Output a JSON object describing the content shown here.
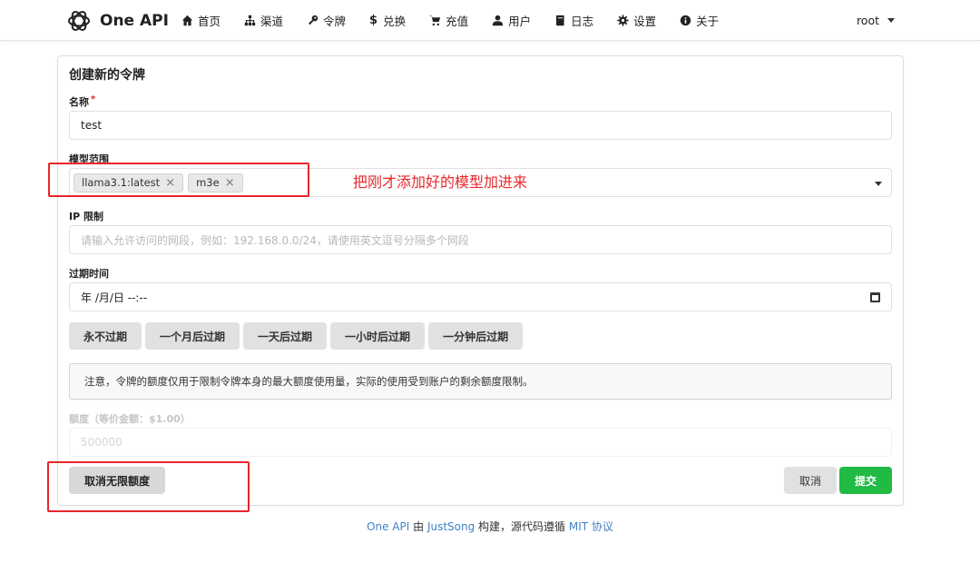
{
  "app": {
    "name": "One API"
  },
  "nav": {
    "items": [
      {
        "label": "首页",
        "icon": "home-icon"
      },
      {
        "label": "渠道",
        "icon": "sitemap-icon"
      },
      {
        "label": "令牌",
        "icon": "key-icon"
      },
      {
        "label": "兑换",
        "icon": "dollar-icon"
      },
      {
        "label": "充值",
        "icon": "cart-icon"
      },
      {
        "label": "用户",
        "icon": "user-icon"
      },
      {
        "label": "日志",
        "icon": "book-icon"
      },
      {
        "label": "设置",
        "icon": "gear-icon"
      },
      {
        "label": "关于",
        "icon": "info-icon"
      }
    ],
    "user": "root"
  },
  "form": {
    "title": "创建新的令牌",
    "name_label": "名称",
    "required_mark": "*",
    "name_value": "test",
    "models_label": "模型范围",
    "models": [
      "llama3.1:latest",
      "m3e"
    ],
    "chip_remove": "×",
    "ip_label": "IP 限制",
    "ip_placeholder": "请输入允许访问的网段，例如：192.168.0.0/24，请使用英文逗号分隔多个网段",
    "expire_label": "过期时间",
    "expire_value": "年 /月/日 --:--",
    "expire_buttons": [
      "永不过期",
      "一个月后过期",
      "一天后过期",
      "一小时后过期",
      "一分钟后过期"
    ],
    "notice": "注意，令牌的额度仅用于限制令牌本身的最大额度使用量，实际的使用受到账户的剩余额度限制。",
    "quota_label": "额度（等价金额：$1.00）",
    "quota_placeholder": "500000",
    "cancel_unlimited": "取消无限额度",
    "cancel": "取消",
    "submit": "提交"
  },
  "annotation": {
    "text": "把刚才添加好的模型加进来",
    "color": "#e8262b"
  },
  "footer": {
    "app_link": "One API",
    "by": " 由 ",
    "author_link": "JustSong",
    "built": " 构建，源代码遵循 ",
    "license_link": "MIT 协议"
  },
  "colors": {
    "submit": "#21ba45",
    "link": "#4183c4"
  }
}
